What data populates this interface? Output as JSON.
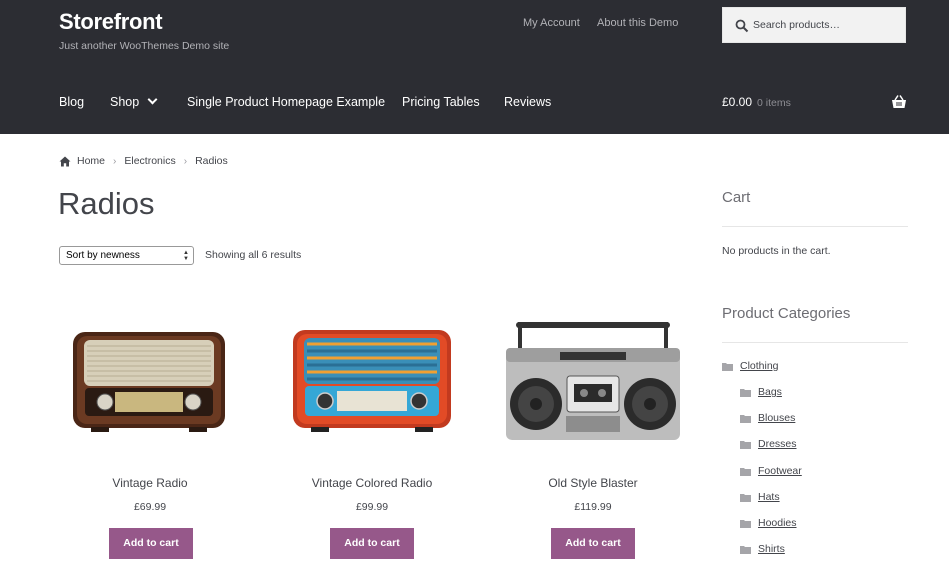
{
  "header": {
    "site_title": "Storefront",
    "site_description": "Just another WooThemes Demo site",
    "top_links": [
      "My Account",
      "About this Demo"
    ],
    "search_placeholder": "Search products…",
    "nav": [
      "Blog",
      "Shop",
      "Single Product Homepage Example",
      "Pricing Tables",
      "Reviews"
    ],
    "cart_total": "£0.00",
    "cart_count": "0 items",
    "background": "#2c2d33"
  },
  "breadcrumb": [
    "Home",
    "Electronics",
    "Radios"
  ],
  "page_title": "Radios",
  "sort": {
    "selected": "Sort by newness"
  },
  "result_count": "Showing all 6 results",
  "products": [
    {
      "name": "Vintage Radio",
      "price": "£69.99",
      "button": "Add to cart"
    },
    {
      "name": "Vintage Colored Radio",
      "price": "£99.99",
      "button": "Add to cart"
    },
    {
      "name": "Old Style Blaster",
      "price": "£119.99",
      "button": "Add to cart"
    }
  ],
  "sidebar": {
    "cart_title": "Cart",
    "cart_empty": "No products in the cart.",
    "categories_title": "Product Categories",
    "categories": [
      "Clothing",
      "Bags",
      "Blouses",
      "Dresses",
      "Footwear",
      "Hats",
      "Hoodies",
      "Shirts"
    ]
  },
  "colors": {
    "accent": "#96588a",
    "header_bg": "#2c2d33"
  }
}
